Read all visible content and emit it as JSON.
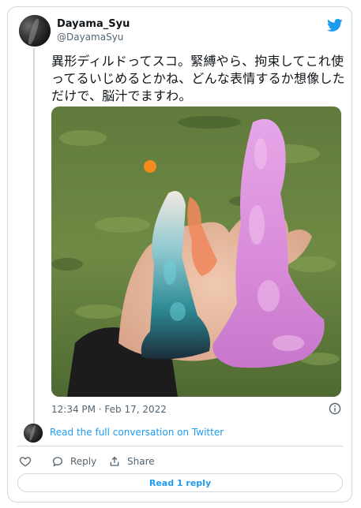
{
  "author": {
    "name": "Dayama_Syu",
    "handle": "@DayamaSyu"
  },
  "tweet": {
    "text": "異形ディルドってスコ。緊縛やら、拘束してこれ使ってるいじめるとかね、どんな表情するか想像しただけで、脳汁でますわ。",
    "photo_icon": "photo-two-fantasy-toys-held-in-hand-over-grass",
    "timestamp": "12:34 PM · Feb 17, 2022"
  },
  "conversation_link": "Read the full conversation on Twitter",
  "actions": {
    "like_icon": "heart-icon",
    "reply_label": "Reply",
    "share_label": "Share"
  },
  "read_reply_label": "Read 1 reply",
  "colors": {
    "accent": "#1d9bf0",
    "text": "#0f1419",
    "muted": "#536471",
    "border": "#cfd9de"
  }
}
